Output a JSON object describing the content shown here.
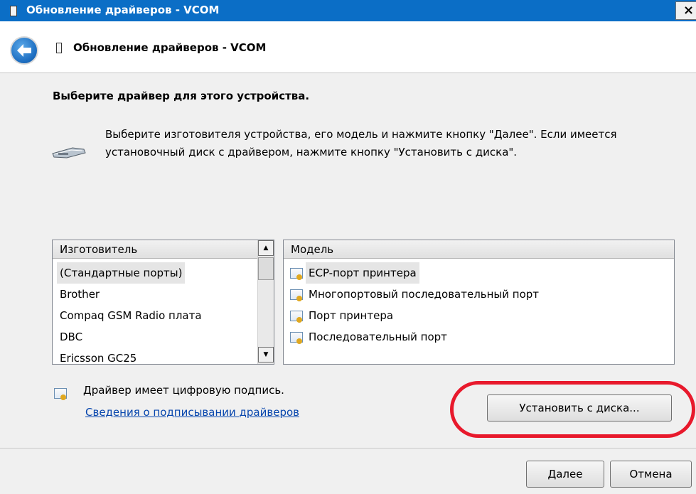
{
  "window": {
    "title": "Обновление драйверов - VCOM",
    "close_glyph": "×"
  },
  "header": {
    "title": "Обновление драйверов - VCOM"
  },
  "main": {
    "heading": "Выберите драйвер для этого устройства.",
    "description": "Выберите изготовителя устройства, его модель и нажмите кнопку \"Далее\". Если имеется установочный диск с  драйвером, нажмите кнопку \"Установить с диска\"."
  },
  "manufacturer_list": {
    "header": "Изготовитель",
    "items": [
      "(Стандартные порты)",
      "Brother",
      "Compaq GSM Radio плата",
      "DBC",
      "Ericsson GC25"
    ],
    "selected_index": 0
  },
  "model_list": {
    "header": "Модель",
    "items": [
      "ECP-порт принтера",
      "Многопортовый последовательный порт",
      "Порт принтера",
      "Последовательный порт"
    ],
    "selected_index": 0
  },
  "signature": {
    "text": "Драйвер имеет цифровую подпись.",
    "link": "Сведения о подписывании драйверов"
  },
  "buttons": {
    "install": "Установить с диска...",
    "next": "Далее",
    "cancel": "Отмена"
  },
  "colors": {
    "titlebar": "#0b6ec6",
    "highlight": "#e8192c",
    "link": "#0645ad"
  },
  "icons": {
    "back": "back-arrow-icon",
    "device": "serial-port-icon",
    "certificate": "certificate-icon"
  }
}
